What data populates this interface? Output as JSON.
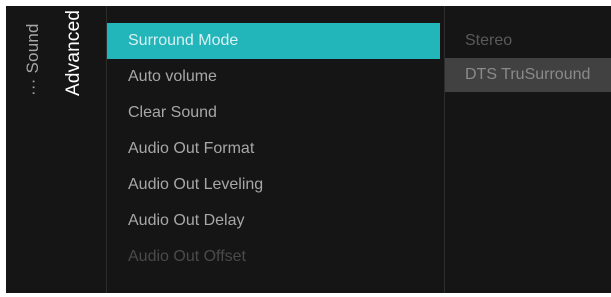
{
  "breadcrumb": {
    "parent": "··· Sound",
    "current": "Advanced"
  },
  "menu": {
    "items": [
      {
        "label": "Surround Mode",
        "state": "selected"
      },
      {
        "label": "Auto volume",
        "state": "normal"
      },
      {
        "label": "Clear Sound",
        "state": "normal"
      },
      {
        "label": "Audio Out Format",
        "state": "normal"
      },
      {
        "label": "Audio Out Leveling",
        "state": "normal"
      },
      {
        "label": "Audio Out Delay",
        "state": "normal"
      },
      {
        "label": "Audio Out Offset",
        "state": "disabled"
      }
    ]
  },
  "options": {
    "items": [
      {
        "label": "Stereo",
        "state": "normal"
      },
      {
        "label": "DTS TruSurround",
        "state": "highlighted"
      }
    ]
  },
  "colors": {
    "accent": "#22b5b9",
    "background": "#151515"
  }
}
